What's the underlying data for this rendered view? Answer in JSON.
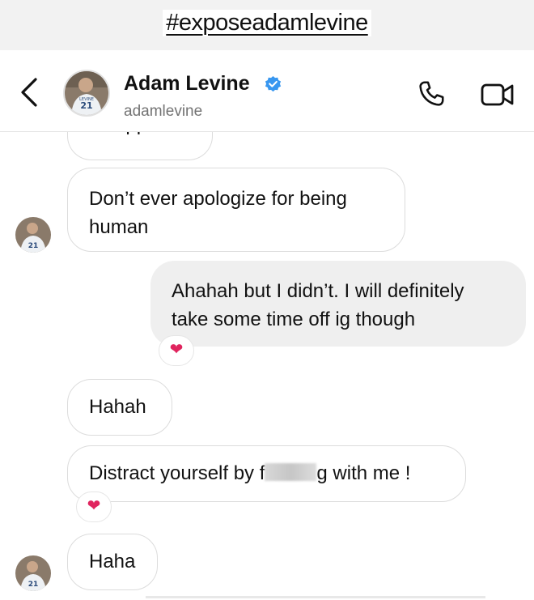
{
  "hashtag": "#exposeadamlevine",
  "header": {
    "name": "Adam Levine",
    "username": "adamlevine"
  },
  "messages": [
    {
      "from": "them",
      "text": "it happens"
    },
    {
      "from": "them",
      "text": "Don’t ever apologize for being human"
    },
    {
      "from": "me",
      "text": "Ahahah but I didn’t. I will definitely take some time off ig though",
      "reaction": "❤"
    },
    {
      "from": "them",
      "text": "Hahah"
    },
    {
      "from": "them",
      "text_before": "Distract yourself by f",
      "text_after": "g with me !",
      "reaction": "❤"
    },
    {
      "from": "them",
      "text": "Haha"
    }
  ],
  "colors": {
    "verified_blue": "#3897f0",
    "heart_red": "#e0245e",
    "outgoing_bubble": "#efefef",
    "incoming_border": "#dcdcdc"
  },
  "icons": [
    "back-arrow-icon",
    "verified-badge-icon",
    "phone-icon",
    "video-camera-icon",
    "heart-icon"
  ]
}
